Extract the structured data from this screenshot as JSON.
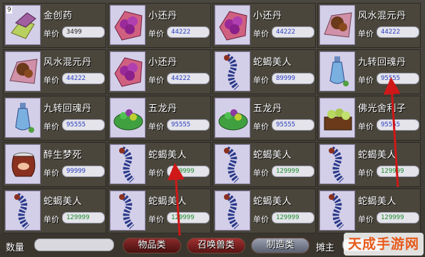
{
  "items": [
    {
      "slot": "9",
      "name": "金创药",
      "price": "3499",
      "price_color": "dark",
      "icon": "golden-medicine-icon"
    },
    {
      "name": "小还丹",
      "price": "44222",
      "price_color": "blue",
      "icon": "purple-pill-icon"
    },
    {
      "name": "小还丹",
      "price": "44222",
      "price_color": "blue",
      "icon": "purple-pill-icon"
    },
    {
      "name": "风水混元丹",
      "price": "44222",
      "price_color": "blue",
      "icon": "brown-pill-cloth-icon"
    },
    {
      "name": "风水混元丹",
      "price": "44222",
      "price_color": "blue",
      "icon": "brown-pill-cloth-icon"
    },
    {
      "name": "小还丹",
      "price": "44222",
      "price_color": "blue",
      "icon": "purple-pill-icon"
    },
    {
      "name": "蛇蝎美人",
      "price": "89999",
      "price_color": "blue",
      "icon": "blue-worm-icon"
    },
    {
      "name": "九转回魂丹",
      "price": "95555",
      "price_color": "blue",
      "icon": "blue-bottle-icon"
    },
    {
      "name": "九转回魂丹",
      "price": "95555",
      "price_color": "blue",
      "icon": "blue-bottle-icon"
    },
    {
      "name": "五龙丹",
      "price": "95555",
      "price_color": "blue",
      "icon": "green-leaf-pills-icon"
    },
    {
      "name": "五龙丹",
      "price": "95555",
      "price_color": "blue",
      "icon": "green-leaf-pills-icon"
    },
    {
      "name": "佛光舍利子",
      "price": "95555",
      "price_color": "blue",
      "icon": "green-beads-box-icon"
    },
    {
      "name": "醉生梦死",
      "price": "99999",
      "price_color": "blue",
      "icon": "wine-jar-icon"
    },
    {
      "name": "蛇蝎美人",
      "price": "129999",
      "price_color": "green",
      "icon": "blue-worm-icon"
    },
    {
      "name": "蛇蝎美人",
      "price": "129999",
      "price_color": "green",
      "icon": "blue-worm-icon"
    },
    {
      "name": "蛇蝎美人",
      "price": "129999",
      "price_color": "green",
      "icon": "blue-worm-icon"
    },
    {
      "name": "蛇蝎美人",
      "price": "129999",
      "price_color": "green",
      "icon": "blue-worm-icon"
    },
    {
      "name": "蛇蝎美人",
      "price": "129999",
      "price_color": "green",
      "icon": "blue-worm-icon"
    },
    {
      "name": "蛇蝎美人",
      "price": "129999",
      "price_color": "green",
      "icon": "blue-worm-icon"
    },
    {
      "name": "蛇蝎美人",
      "price": "129999",
      "price_color": "green",
      "icon": "blue-worm-icon"
    }
  ],
  "price_label": "单价",
  "footer": {
    "qty_label": "数量",
    "tabs": [
      "物品类",
      "召唤兽类",
      "制造类"
    ],
    "active_tab": "物品类",
    "seller_label": "摊主"
  },
  "watermark": "天成手游网",
  "colors": {
    "price_dark": "#222222",
    "price_blue": "#2a3cc0",
    "price_green": "#1a8a2a",
    "arrow": "#d01818"
  }
}
